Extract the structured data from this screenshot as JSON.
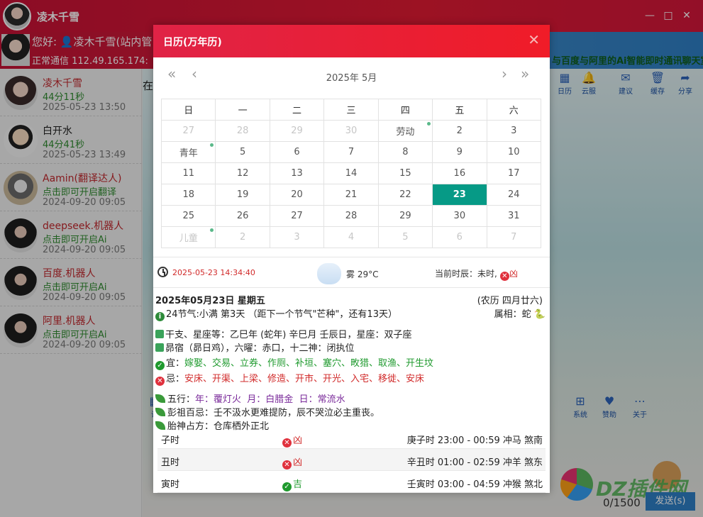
{
  "app": {
    "title": "凌木千雪",
    "window_buttons": [
      "—",
      "□",
      "✕"
    ],
    "greeting": "您好: 👤凌木千雪(站内管",
    "ip_line": "正常通信 112.49.165.174:",
    "right_note_1": "",
    "right_note_2": "与百度与阿里的Ai智能即时通讯聊天室",
    "main_caption": "在",
    "counter": "0/1500",
    "send_label": "发送(s)",
    "watermark_text": "DZ插件网"
  },
  "toolbar": [
    {
      "icon": "calendar-icon",
      "label": "日历"
    },
    {
      "icon": "bell-icon",
      "label": "云服"
    },
    {
      "icon": "mail-icon",
      "label": "建议"
    },
    {
      "icon": "trash-icon",
      "label": "缓存"
    },
    {
      "icon": "share-icon",
      "label": "分享"
    }
  ],
  "bottom_toolbar": [
    {
      "icon": "settings-icon",
      "label": "设"
    },
    {
      "icon": "windows-icon",
      "label": "系统"
    },
    {
      "icon": "heart-icon",
      "label": "赞助"
    },
    {
      "icon": "more-icon",
      "label": "关于"
    }
  ],
  "contacts": [
    {
      "name": "凌木千雪",
      "status": "44分11秒",
      "time": "2025-05-23 13:50",
      "name_color": "#c0282d"
    },
    {
      "name": "白开水",
      "status": "44分41秒",
      "time": "2025-05-23 13:49",
      "name_color": "#222222"
    },
    {
      "name": "Aamin(翻译达人)",
      "status": "点击即可开启翻译",
      "time": "2024-09-20 09:05",
      "name_color": "#c0282d"
    },
    {
      "name": "deepseek.机器人",
      "status": "点击即可开启Ai",
      "time": "2024-09-20 09:05",
      "name_color": "#c0282d"
    },
    {
      "name": "百度.机器人",
      "status": "点击即可开启Ai",
      "time": "2024-09-20 09:05",
      "name_color": "#c0282d"
    },
    {
      "name": "阿里.机器人",
      "status": "点击即可开启Ai",
      "time": "2024-09-20 09:05",
      "name_color": "#c0282d"
    }
  ],
  "dialog": {
    "title": "日历(万年历)",
    "close": "✕",
    "nav_prev_year": "«",
    "nav_prev_month": "‹",
    "nav_next_month": "›",
    "nav_next_year": "»",
    "year_month": "2025年   5月",
    "weekdays": [
      "日",
      "一",
      "二",
      "三",
      "四",
      "五",
      "六"
    ],
    "weeks": [
      [
        {
          "t": "27",
          "o": 1
        },
        {
          "t": "28",
          "o": 1
        },
        {
          "t": "29",
          "o": 1
        },
        {
          "t": "30",
          "o": 1
        },
        {
          "t": "劳动",
          "dot": 1
        },
        {
          "t": "2"
        },
        {
          "t": "3"
        }
      ],
      [
        {
          "t": "青年",
          "dot": 1
        },
        {
          "t": "5"
        },
        {
          "t": "6"
        },
        {
          "t": "7"
        },
        {
          "t": "8"
        },
        {
          "t": "9"
        },
        {
          "t": "10"
        }
      ],
      [
        {
          "t": "11"
        },
        {
          "t": "12"
        },
        {
          "t": "13"
        },
        {
          "t": "14"
        },
        {
          "t": "15"
        },
        {
          "t": "16"
        },
        {
          "t": "17"
        }
      ],
      [
        {
          "t": "18"
        },
        {
          "t": "19"
        },
        {
          "t": "20"
        },
        {
          "t": "21"
        },
        {
          "t": "22"
        },
        {
          "t": "23",
          "today": 1
        },
        {
          "t": "24"
        }
      ],
      [
        {
          "t": "25"
        },
        {
          "t": "26"
        },
        {
          "t": "27"
        },
        {
          "t": "28"
        },
        {
          "t": "29"
        },
        {
          "t": "30"
        },
        {
          "t": "31"
        }
      ],
      [
        {
          "t": "儿童",
          "o": 1,
          "dot": 1
        },
        {
          "t": "2",
          "o": 1
        },
        {
          "t": "3",
          "o": 1
        },
        {
          "t": "4",
          "o": 1
        },
        {
          "t": "5",
          "o": 1
        },
        {
          "t": "6",
          "o": 1
        },
        {
          "t": "7",
          "o": 1
        }
      ]
    ],
    "now_time": "2025-05-23 14:34:40",
    "weather": "雾 29°C",
    "shichen_label": "当前时辰：未时,",
    "shichen_luck": "凶",
    "date_title": "2025年05月23日 星期五",
    "lunar": "(农历 四月廿六)",
    "solar_term": "24节气:小满 第3天 （距下一个节气\"芒种\"，还有13天）",
    "zodiac": "属相：蛇 🐍",
    "ganzhi": "干支、星座等：乙巳年 (蛇年) 辛巳月 壬辰日，星座：双子座",
    "xiu": "昴宿（昴日鸡），六曜：赤口，十二神：闭执位",
    "yi_label": "宜：",
    "yi": "嫁娶、交易、立券、作厕、补垣、塞穴、畋猎、取渔、开生坟",
    "ji_label": "忌：",
    "ji": "安床、开渠、上梁、修造、开市、开光、入宅、移徙、安床",
    "wuxing_label": "五行：",
    "wuxing_year": "年：覆灯火",
    "wuxing_month": "月：白腊金",
    "wuxing_day": "日：常流水",
    "pengzu": "彭祖百忌：壬不汲水更难提防，辰不哭泣必主重丧。",
    "taishen": "胎神占方：仓库栖外正北",
    "hours": [
      {
        "name": "子时",
        "luck": "凶",
        "good": false,
        "detail": "庚子时 23:00 - 00:59 冲马 煞南"
      },
      {
        "name": "丑时",
        "luck": "凶",
        "good": false,
        "detail": "辛丑时 01:00 - 02:59 冲羊 煞东"
      },
      {
        "name": "寅时",
        "luck": "吉",
        "good": true,
        "detail": "壬寅时 03:00 - 04:59 冲猴 煞北"
      }
    ]
  }
}
